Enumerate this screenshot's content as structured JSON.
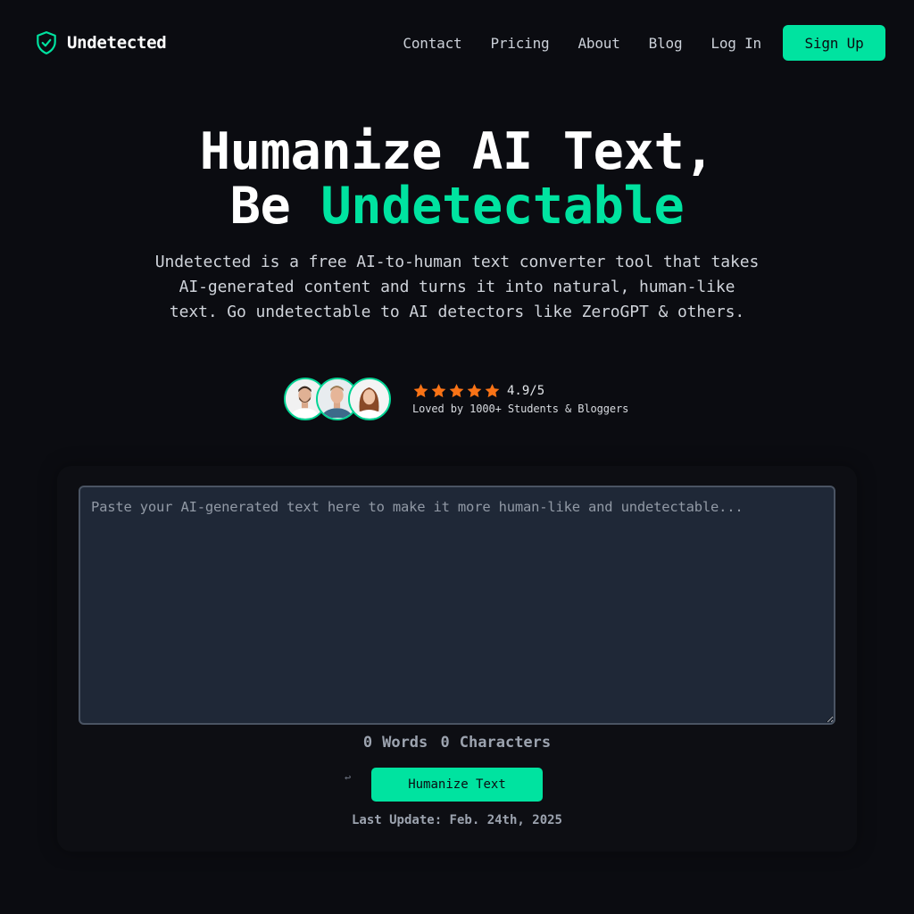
{
  "brand": {
    "name": "Undetected",
    "logo_icon": "shield-check-icon"
  },
  "nav": {
    "links": [
      "Contact",
      "Pricing",
      "About",
      "Blog",
      "Log In"
    ],
    "signup_label": "Sign Up"
  },
  "hero": {
    "title_line1": "Humanize AI Text,",
    "title_line2_prefix": "Be ",
    "title_line2_accent": "Undetectable",
    "subtitle": "Undetected is a free AI-to-human text converter tool that takes AI-generated content and turns it into natural, human-like text. Go undetectable to AI detectors like ZeroGPT & others."
  },
  "social_proof": {
    "rating": 4.9,
    "rating_max": 5,
    "rating_text": "4.9/5",
    "stars": 5,
    "loved_text": "Loved by 1000+ Students & Bloggers",
    "avatars": [
      "avatar-man-beard",
      "avatar-man-smiling",
      "avatar-woman"
    ]
  },
  "editor": {
    "placeholder": "Paste your AI-generated text here to make it more human-like and undetectable...",
    "value": "",
    "word_count": "0",
    "words_label": "Words",
    "char_count": "0",
    "chars_label": "Characters",
    "undo_icon": "↩",
    "humanize_label": "Humanize Text",
    "last_update": "Last Update: Feb. 24th, 2025"
  },
  "colors": {
    "accent": "#00e3a0",
    "background": "#0b0c11",
    "star": "#f97316",
    "textarea_bg": "#1f2837"
  }
}
